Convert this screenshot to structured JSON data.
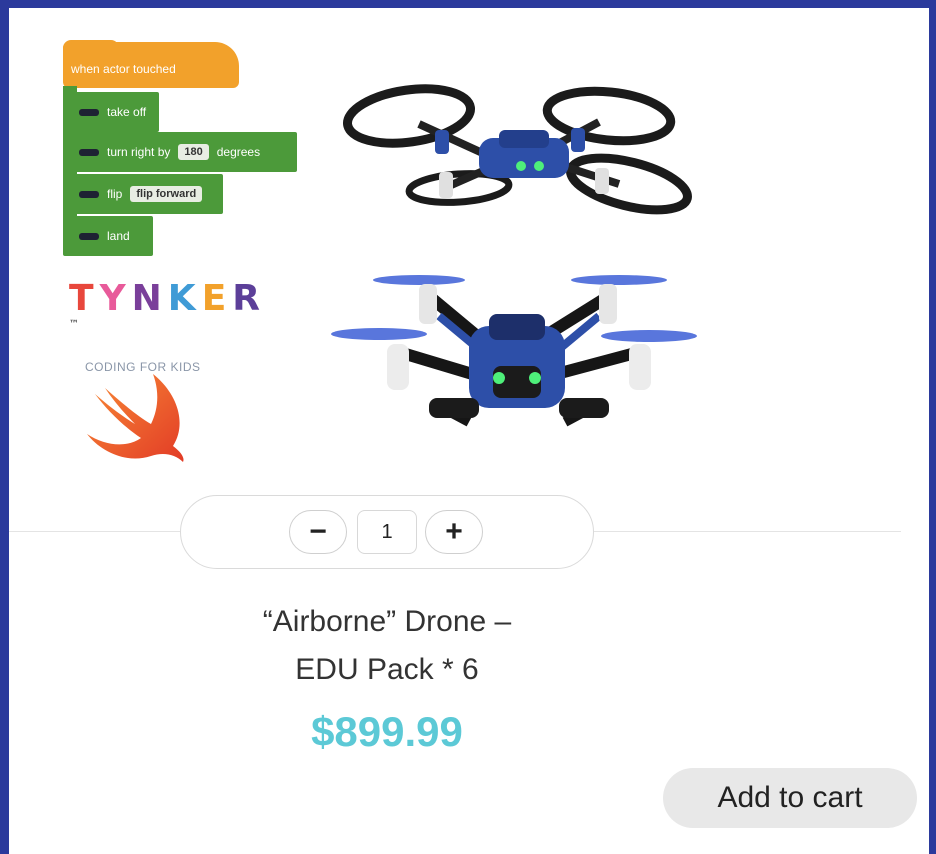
{
  "image": {
    "blocks": {
      "hat_label": "when actor touched",
      "commands": [
        {
          "label": "take off",
          "value": ""
        },
        {
          "label": "turn right by",
          "value": "180",
          "suffix": "degrees"
        },
        {
          "label": "flip",
          "value": "flip forward",
          "suffix": ""
        },
        {
          "label": "land",
          "value": ""
        }
      ]
    },
    "tynker": {
      "letters": [
        "T",
        "Y",
        "N",
        "K",
        "E",
        "R"
      ],
      "tm": "™",
      "tagline": "CODING FOR KIDS"
    },
    "icons": [
      "swift-logo-icon",
      "drone-icon"
    ]
  },
  "quantity": {
    "minus": "−",
    "value": "1",
    "plus": "+"
  },
  "product": {
    "title_line1": "“Airborne” Drone –",
    "title_line2": "EDU Pack * 6",
    "price": "$899.99"
  },
  "cart": {
    "button_label": "Add to cart"
  },
  "colors": {
    "frame": "#2b3a9c",
    "price": "#5cc9d6",
    "block_green": "#4c9a3a",
    "block_orange": "#f2a12b",
    "button_bg": "#e8e8e8"
  }
}
